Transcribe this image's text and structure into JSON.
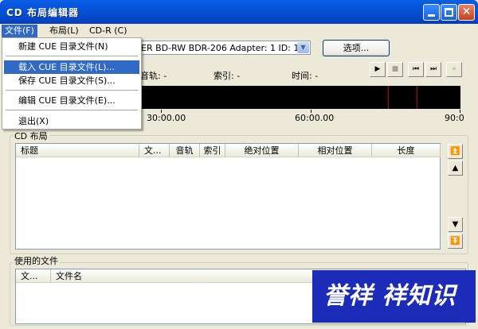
{
  "window": {
    "title": "CD 布局编辑器",
    "close_glyph": "✕"
  },
  "menu": {
    "file": "文件(F)",
    "layout": "布局(L)",
    "cdr": "CD-R (C)"
  },
  "file_menu": {
    "items": [
      "新建 CUE 目录文件(N)",
      "载入 CUE 目录文件(L)...",
      "保存 CUE 目录文件(S)...",
      "编辑 CUE 目录文件(E)...",
      "退出(X)"
    ]
  },
  "drive": {
    "value": "ER BD-RW  BDR-206  Adapter: 1  ID: 1"
  },
  "options_button": "选项...",
  "status": {
    "track": "音轨: -",
    "index": "索引: -",
    "time": "时间: -"
  },
  "transport": {
    "play": "▶",
    "stop": "■",
    "prev": "⏮",
    "next": "⏭",
    "ff": "»"
  },
  "timeline": {
    "labels": [
      "30:00.00",
      "60:00.00",
      "90:0"
    ],
    "marker_positions_min": [
      75,
      81
    ]
  },
  "cd_layout": {
    "title": "CD 布局",
    "columns": [
      "标题",
      "文...",
      "音轨",
      "索引",
      "绝对位置",
      "相对位置",
      "长度"
    ]
  },
  "side_buttons": {
    "top": "⏫",
    "up": "▲",
    "down": "▼",
    "bottom": "⏬"
  },
  "used_files": {
    "title": "使用的文件",
    "columns": [
      "文...",
      "文件名"
    ]
  },
  "watermark": "誉祥 祥知识"
}
